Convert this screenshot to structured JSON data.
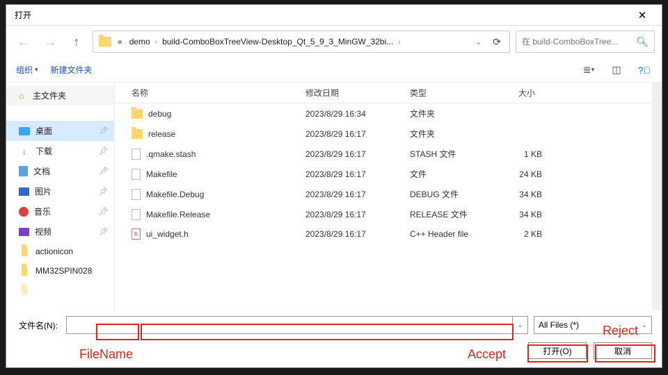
{
  "title": "打开",
  "path": {
    "root_sep": "«",
    "seg1": "demo",
    "seg2": "build-ComboBoxTreeView-Desktop_Qt_5_9_3_MinGW_32bi..."
  },
  "search_placeholder": "在 build-ComboBoxTree...",
  "toolbar": {
    "organize": "组织",
    "newfolder": "新建文件夹"
  },
  "sidebar": {
    "main": "主文件夹",
    "items": [
      "桌面",
      "下载",
      "文档",
      "图片",
      "音乐",
      "视频",
      "actionicon",
      "MM32SPIN028"
    ]
  },
  "columns": {
    "name": "名称",
    "date": "修改日期",
    "type": "类型",
    "size": "大小"
  },
  "files": [
    {
      "icon": "folder",
      "name": "debug",
      "date": "2023/8/29 16:34",
      "type": "文件夹",
      "size": ""
    },
    {
      "icon": "folder",
      "name": "release",
      "date": "2023/8/29 16:17",
      "type": "文件夹",
      "size": ""
    },
    {
      "icon": "file",
      "name": ".qmake.stash",
      "date": "2023/8/29 16:17",
      "type": "STASH 文件",
      "size": "1 KB"
    },
    {
      "icon": "file",
      "name": "Makefile",
      "date": "2023/8/29 16:17",
      "type": "文件",
      "size": "24 KB"
    },
    {
      "icon": "file",
      "name": "Makefile.Debug",
      "date": "2023/8/29 16:17",
      "type": "DEBUG 文件",
      "size": "34 KB"
    },
    {
      "icon": "file",
      "name": "Makefile.Release",
      "date": "2023/8/29 16:17",
      "type": "RELEASE 文件",
      "size": "34 KB"
    },
    {
      "icon": "h",
      "name": "ui_widget.h",
      "date": "2023/8/29 16:17",
      "type": "C++ Header file",
      "size": "2 KB"
    }
  ],
  "footer": {
    "filename_label": "文件名(N):",
    "filter": "All Files (*)",
    "open": "打开(O)",
    "cancel": "取消"
  },
  "annotations": {
    "filename": "FileName",
    "accept": "Accept",
    "reject": "Reject"
  }
}
